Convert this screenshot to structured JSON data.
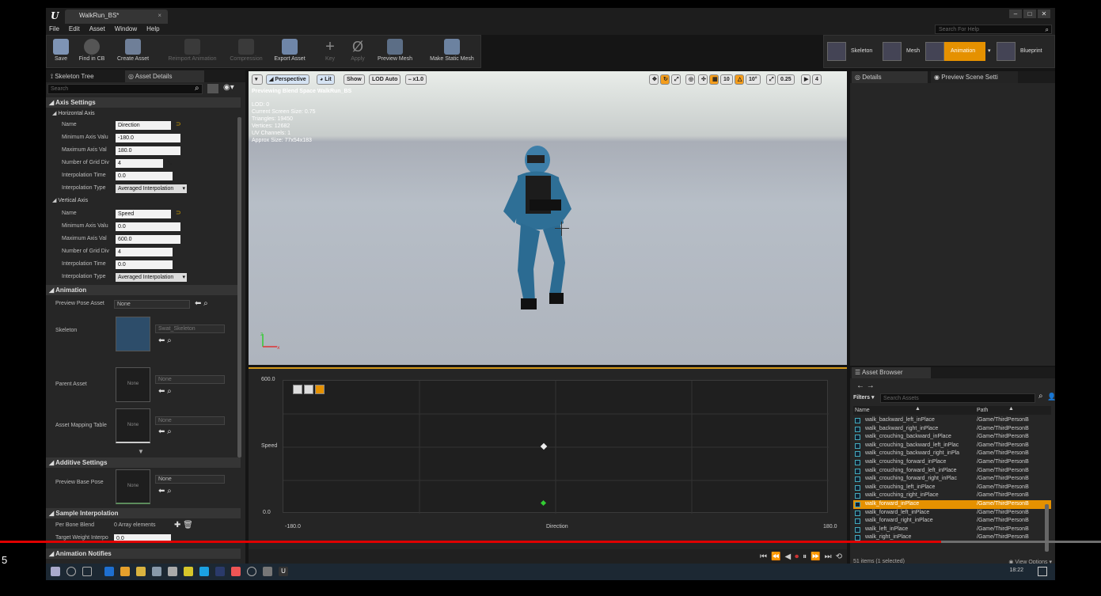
{
  "window": {
    "tab_title": "WalkRun_BS*",
    "menu": [
      "File",
      "Edit",
      "Asset",
      "Window",
      "Help"
    ],
    "help_search_placeholder": "Search For Help"
  },
  "toolbar": {
    "save": "Save",
    "find_in_cb": "Find in CB",
    "create_asset": "Create Asset",
    "reimport_animation": "Reimport Animation",
    "compression": "Compression",
    "export_asset": "Export Asset",
    "key": "Key",
    "apply": "Apply",
    "preview_mesh": "Preview Mesh",
    "make_static_mesh": "Make Static Mesh"
  },
  "modes": {
    "skeleton": "Skeleton",
    "mesh": "Mesh",
    "animation": "Animation",
    "blueprint": "Blueprint"
  },
  "left_panel": {
    "tab_skeleton_tree": "Skeleton Tree",
    "tab_asset_details": "Asset Details",
    "search_placeholder": "Search",
    "axis_settings": "Axis Settings",
    "horizontal_axis": "Horizontal Axis",
    "vertical_axis": "Vertical Axis",
    "h_props": [
      {
        "label": "Name",
        "value": "Direction"
      },
      {
        "label": "Minimum Axis Valu",
        "value": "-180.0"
      },
      {
        "label": "Maximum Axis Val",
        "value": "180.0"
      },
      {
        "label": "Number of Grid Div",
        "value": "4"
      },
      {
        "label": "Interpolation Time",
        "value": "0.0"
      },
      {
        "label": "Interpolation Type",
        "value": "Averaged Interpolation"
      }
    ],
    "v_props": [
      {
        "label": "Name",
        "value": "Speed"
      },
      {
        "label": "Minimum Axis Valu",
        "value": "0.0"
      },
      {
        "label": "Maximum Axis Val",
        "value": "600.0"
      },
      {
        "label": "Number of Grid Div",
        "value": "4"
      },
      {
        "label": "Interpolation Time",
        "value": "0.0"
      },
      {
        "label": "Interpolation Type",
        "value": "Averaged Interpolation"
      }
    ],
    "animation": "Animation",
    "preview_pose_asset_label": "Preview Pose Asset",
    "preview_pose_asset_value": "None",
    "skeleton_label": "Skeleton",
    "skeleton_value": "Swat_Skeleton",
    "parent_asset_label": "Parent Asset",
    "parent_asset_value": "None",
    "none_thumb": "None",
    "asset_mapping_label": "Asset Mapping Table",
    "asset_mapping_value": "None",
    "additive_settings": "Additive Settings",
    "preview_base_pose_label": "Preview Base Pose",
    "preview_base_pose_value": "None",
    "sample_interpolation": "Sample Interpolation",
    "per_bone_blend_label": "Per Bone Blend",
    "per_bone_blend_value": "0 Array elements",
    "target_weight_label": "Target Weight Interpo",
    "target_weight_value": "0.0",
    "animation_notifies": "Animation Notifies"
  },
  "viewport": {
    "perspective": "Perspective",
    "lit": "Lit",
    "show": "Show",
    "lod": "LOD Auto",
    "speed": "x1.0",
    "grid_snap": "10",
    "rot_snap": "10°",
    "scale_snap": "0.25",
    "cam_speed": "4",
    "previewing": "Previewing Blend Space WalkRun_BS",
    "info": [
      "LOD: 0",
      "Current Screen Size: 0.75",
      "Triangles: 19450",
      "Vertices: 12682",
      "UV Channels: 1",
      "Approx Size: 77x54x183"
    ]
  },
  "graph": {
    "y_max": "600.0",
    "y_label": "Speed",
    "y_min": "0.0",
    "x_min": "-180.0",
    "x_label": "Direction",
    "x_max": "180.0"
  },
  "right_panel": {
    "tab_details": "Details",
    "tab_preview_scene": "Preview Scene Setti",
    "tab_asset_browser": "Asset Browser",
    "filters": "Filters",
    "search_placeholder": "Search Assets",
    "col_name": "Name",
    "col_path": "Path",
    "items": [
      {
        "name": "walk_backward_left_inPlace",
        "path": "/Game/ThirdPersonB"
      },
      {
        "name": "walk_backward_right_inPlace",
        "path": "/Game/ThirdPersonB"
      },
      {
        "name": "walk_crouching_backward_inPlace",
        "path": "/Game/ThirdPersonB"
      },
      {
        "name": "walk_crouching_backward_left_inPlac",
        "path": "/Game/ThirdPersonB"
      },
      {
        "name": "walk_crouching_backward_right_inPla",
        "path": "/Game/ThirdPersonB"
      },
      {
        "name": "walk_crouching_forward_inPlace",
        "path": "/Game/ThirdPersonB"
      },
      {
        "name": "walk_crouching_forward_left_inPlace",
        "path": "/Game/ThirdPersonB"
      },
      {
        "name": "walk_crouching_forward_right_inPlac",
        "path": "/Game/ThirdPersonB"
      },
      {
        "name": "walk_crouching_left_inPlace",
        "path": "/Game/ThirdPersonB"
      },
      {
        "name": "walk_crouching_right_inPlace",
        "path": "/Game/ThirdPersonB"
      },
      {
        "name": "walk_forward_inPlace",
        "path": "/Game/ThirdPersonB",
        "selected": true
      },
      {
        "name": "walk_forward_left_inPlace",
        "path": "/Game/ThirdPersonB"
      },
      {
        "name": "walk_forward_right_inPlace",
        "path": "/Game/ThirdPersonB"
      },
      {
        "name": "walk_left_inPlace",
        "path": "/Game/ThirdPersonB"
      },
      {
        "name": "walk_right_inPlace",
        "path": "/Game/ThirdPersonB"
      }
    ],
    "footer": "51 items (1 selected)",
    "view_options": "View Options"
  },
  "video": {
    "time": "5",
    "progress": 0.855
  },
  "taskbar": {
    "clock": "18:22"
  },
  "colors": {
    "accent": "#e59100",
    "progress": "#e00000"
  }
}
